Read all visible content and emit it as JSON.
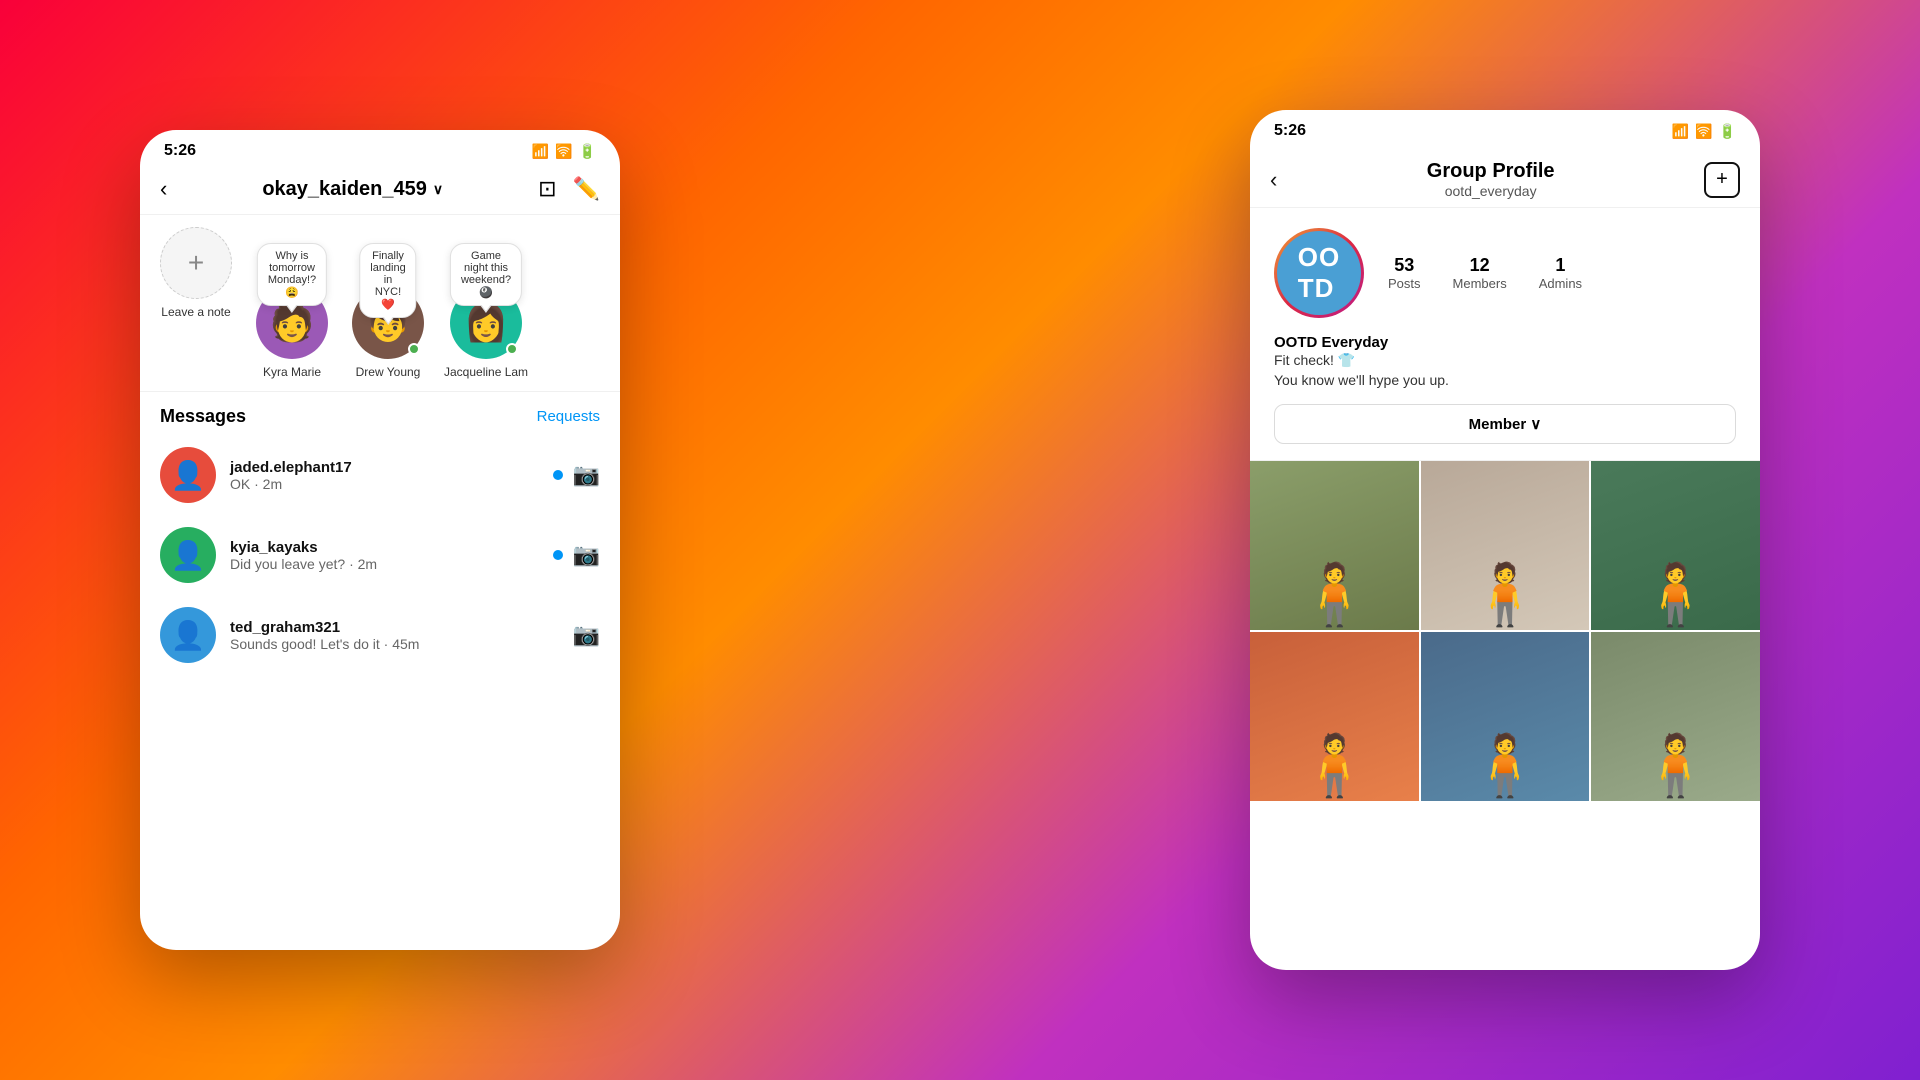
{
  "background": {
    "gradient": "linear-gradient(135deg, #f9003a 0%, #ff6600 30%, #ff8c00 45%, #c030c0 70%, #8020d0 100%)"
  },
  "left_phone": {
    "status_bar": {
      "time": "5:26",
      "signal": "▂▄▆",
      "wifi": "WiFi",
      "battery": "🔋"
    },
    "header": {
      "back_icon": "<",
      "title": "okay_kaiden_459",
      "chevron": "∨",
      "video_icon": "□",
      "edit_icon": "✎"
    },
    "stories": {
      "add_note_label": "Leave a note",
      "items": [
        {
          "name": "Kyra Marie",
          "note": "Why is tomorrow Monday!? 😩",
          "online": false,
          "color": "av-purple"
        },
        {
          "name": "Drew Young",
          "note": "Finally landing in NYC! ❤️",
          "online": true,
          "color": "av-brown"
        },
        {
          "name": "Jacqueline Lam",
          "note": "Game night this weekend? 🎱",
          "online": true,
          "color": "av-teal"
        }
      ]
    },
    "messages_section": {
      "title": "Messages",
      "requests_label": "Requests",
      "items": [
        {
          "username": "jaded.elephant17",
          "preview": "OK · 2m",
          "has_dot": true,
          "color": "av-red"
        },
        {
          "username": "kyia_kayaks",
          "preview": "Did you leave yet? · 2m",
          "has_dot": true,
          "color": "av-green"
        },
        {
          "username": "ted_graham321",
          "preview": "Sounds good! Let's do it · 45m",
          "has_dot": false,
          "color": "av-blue"
        }
      ]
    }
  },
  "right_phone": {
    "status_bar": {
      "time": "5:26",
      "signal": "▂▄▆",
      "wifi": "WiFi",
      "battery": "🔋"
    },
    "header": {
      "back_icon": "<",
      "title": "Group Profile",
      "subtitle": "ootd_everyday",
      "add_icon": "+"
    },
    "group": {
      "avatar_text": "OO\nTD",
      "stats": {
        "posts": "53",
        "posts_label": "Posts",
        "members": "12",
        "members_label": "Members",
        "admins": "1",
        "admins_label": "Admins"
      },
      "bio_name": "OOTD Everyday",
      "bio_line1": "Fit check! 👕",
      "bio_line2": "You know we'll hype you up.",
      "member_button": "Member ∨"
    },
    "photos": [
      {
        "id": "photo-1",
        "class": "photo-1"
      },
      {
        "id": "photo-2",
        "class": "photo-2"
      },
      {
        "id": "photo-3",
        "class": "photo-3"
      },
      {
        "id": "photo-4",
        "class": "photo-4"
      },
      {
        "id": "photo-5",
        "class": "photo-5"
      },
      {
        "id": "photo-6",
        "class": "photo-6"
      }
    ]
  }
}
